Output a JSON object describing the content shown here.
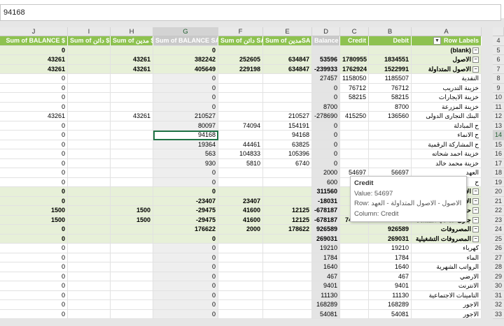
{
  "formula_bar": {
    "value": "94168"
  },
  "columns": [
    {
      "letter": "J"
    },
    {
      "letter": "I"
    },
    {
      "letter": "H"
    },
    {
      "letter": "G",
      "selected": true
    },
    {
      "letter": "F"
    },
    {
      "letter": "E"
    },
    {
      "letter": "D"
    },
    {
      "letter": "C"
    },
    {
      "letter": "B"
    },
    {
      "letter": "A"
    }
  ],
  "header_row": {
    "num": "4",
    "cells": [
      "Sum of BALANCE $",
      "Sum of دائن $",
      "Sum of مدين $",
      "Sum of BALANCE SA",
      "Sum of دائن SA",
      "Sum of مدينSA",
      "Balance",
      "Credit",
      "Debit",
      "Row Labels"
    ]
  },
  "rows": [
    {
      "num": "5",
      "style": "bold",
      "cells": [
        "0",
        "",
        "",
        "0",
        "",
        "",
        "",
        "",
        "",
        "(blank)"
      ],
      "expander": true
    },
    {
      "num": "6",
      "style": "bold",
      "cells": [
        "43261",
        "",
        "43261",
        "382242",
        "252605",
        "634847",
        "53596",
        "1780955",
        "1834551",
        "الاصول"
      ],
      "expander": true
    },
    {
      "num": "7",
      "style": "bold",
      "cells": [
        "43261",
        "",
        "43261",
        "405649",
        "229198",
        "634847",
        "-239933",
        "1762924",
        "1522991",
        "الاصول المتداولة"
      ],
      "expander": true
    },
    {
      "num": "8",
      "style": "",
      "cells": [
        "0",
        "",
        "",
        "0",
        "",
        "",
        "27457",
        "1158050",
        "1185507",
        "النقدية"
      ]
    },
    {
      "num": "9",
      "style": "",
      "cells": [
        "0",
        "",
        "",
        "0",
        "",
        "",
        "0",
        "76712",
        "76712",
        "خزينة التدريب"
      ]
    },
    {
      "num": "10",
      "style": "",
      "cells": [
        "0",
        "",
        "",
        "0",
        "",
        "",
        "0",
        "58215",
        "58215",
        "خزينة الايجارات"
      ]
    },
    {
      "num": "11",
      "style": "",
      "cells": [
        "0",
        "",
        "",
        "0",
        "",
        "",
        "8700",
        "",
        "8700",
        "خزينة المزرعة"
      ]
    },
    {
      "num": "12",
      "style": "",
      "cells": [
        "43261",
        "",
        "43261",
        "210527",
        "",
        "210527",
        "-278690",
        "415250",
        "136560",
        "البنك التجارى الدولى"
      ]
    },
    {
      "num": "13",
      "style": "",
      "cells": [
        "0",
        "",
        "",
        "80097",
        "74094",
        "154191",
        "0",
        "",
        "",
        "ح المبادلة"
      ]
    },
    {
      "num": "14",
      "style": "",
      "cells": [
        "0",
        "",
        "",
        "94168",
        "",
        "94168",
        "0",
        "",
        "",
        "ح الانماء"
      ],
      "active": true
    },
    {
      "num": "15",
      "style": "",
      "cells": [
        "0",
        "",
        "",
        "19364",
        "44461",
        "63825",
        "0",
        "",
        "",
        "ح المشاركة الرقمية"
      ]
    },
    {
      "num": "16",
      "style": "",
      "cells": [
        "0",
        "",
        "",
        "563",
        "104833",
        "105396",
        "0",
        "",
        "",
        "خزينة احمد شحاته"
      ]
    },
    {
      "num": "17",
      "style": "",
      "cells": [
        "0",
        "",
        "",
        "930",
        "5810",
        "6740",
        "0",
        "",
        "",
        "خزينة محمد خالد"
      ]
    },
    {
      "num": "18",
      "style": "",
      "cells": [
        "0",
        "",
        "",
        "0",
        "",
        "",
        "2000",
        "54697",
        "56697",
        "العهد"
      ]
    },
    {
      "num": "19",
      "style": "",
      "cells": [
        "0",
        "",
        "",
        "0",
        "",
        "",
        "600",
        "",
        "",
        "ح"
      ]
    },
    {
      "num": "20",
      "style": "bold",
      "cells": [
        "0",
        "",
        "",
        "0",
        "",
        "",
        "311560",
        "",
        "",
        "الاص"
      ],
      "expander": true
    },
    {
      "num": "21",
      "style": "bold",
      "cells": [
        "0",
        "",
        "",
        "-23407",
        "23407",
        "",
        "-18031",
        "",
        "",
        "الاد"
      ],
      "expander": true
    },
    {
      "num": "22",
      "style": "bold",
      "cells": [
        "1500",
        "",
        "1500",
        "-29475",
        "41600",
        "12125",
        "-678187",
        "",
        "",
        "حقوق"
      ],
      "expander": true
    },
    {
      "num": "23",
      "style": "bold",
      "cells": [
        "1500",
        "",
        "1500",
        "-29475",
        "41600",
        "12125",
        "-678187",
        "744167",
        "65980",
        "جارى صاحب المنشاة"
      ],
      "expander": true
    },
    {
      "num": "24",
      "style": "bold",
      "cells": [
        "0",
        "",
        "",
        "176622",
        "2000",
        "178622",
        "926589",
        "",
        "926589",
        "المصروفات"
      ],
      "expander": true
    },
    {
      "num": "25",
      "style": "bold",
      "cells": [
        "0",
        "",
        "",
        "0",
        "",
        "",
        "269031",
        "",
        "269031",
        "المصروفات التشغيلية"
      ],
      "expander": true
    },
    {
      "num": "26",
      "style": "",
      "cells": [
        "0",
        "",
        "",
        "0",
        "",
        "",
        "19210",
        "",
        "19210",
        "كهرباء"
      ]
    },
    {
      "num": "27",
      "style": "",
      "cells": [
        "0",
        "",
        "",
        "0",
        "",
        "",
        "1784",
        "",
        "1784",
        "الماء"
      ]
    },
    {
      "num": "28",
      "style": "",
      "cells": [
        "0",
        "",
        "",
        "0",
        "",
        "",
        "1640",
        "",
        "1640",
        "الرواتب الشهرية"
      ]
    },
    {
      "num": "29",
      "style": "",
      "cells": [
        "0",
        "",
        "",
        "0",
        "",
        "",
        "467",
        "",
        "467",
        "الارضي"
      ]
    },
    {
      "num": "30",
      "style": "",
      "cells": [
        "0",
        "",
        "",
        "0",
        "",
        "",
        "9401",
        "",
        "9401",
        "الانترنت"
      ]
    },
    {
      "num": "31",
      "style": "",
      "cells": [
        "0",
        "",
        "",
        "0",
        "",
        "",
        "11130",
        "",
        "11130",
        "التامينات الاجتماعية"
      ]
    },
    {
      "num": "32",
      "style": "",
      "cells": [
        "0",
        "",
        "",
        "0",
        "",
        "",
        "168289",
        "",
        "168289",
        "الاجور"
      ]
    },
    {
      "num": "33",
      "style": "",
      "cells": [
        "0",
        "",
        "",
        "0",
        "",
        "",
        "54081",
        "",
        "54081",
        "الاجور"
      ]
    }
  ],
  "tooltip": {
    "title": "Credit",
    "value_line": "Value: 54697",
    "row_line": "Row: الاصول - الاصول المتداولة - العهد",
    "column_line": "Column: Credit"
  }
}
